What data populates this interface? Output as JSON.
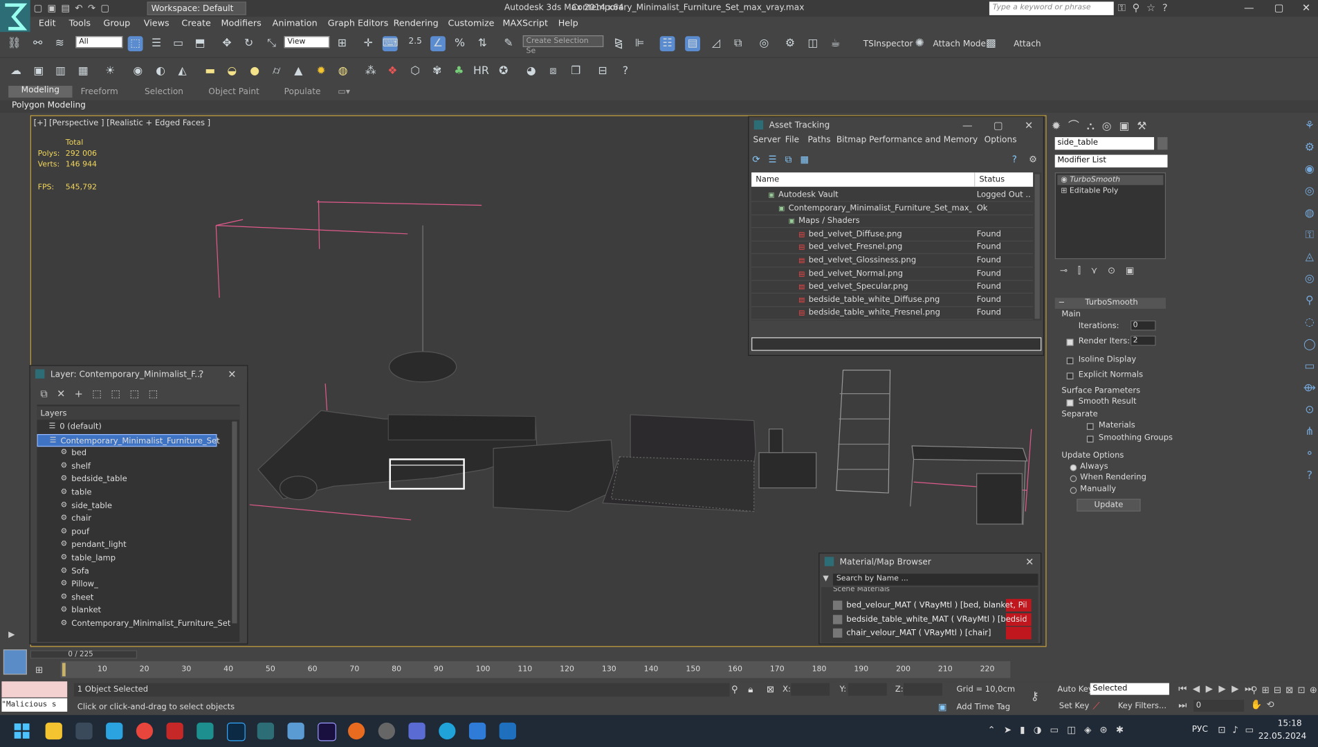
{
  "titlebar": {
    "workspace": "Workspace: Default",
    "app": "Autodesk 3ds Max  2014 x64",
    "file": "Contemporary_Minimalist_Furniture_Set_max_vray.max",
    "search_placeholder": "Type a keyword or phrase"
  },
  "menubar": [
    "Edit",
    "Tools",
    "Group",
    "Views",
    "Create",
    "Modifiers",
    "Animation",
    "Graph Editors",
    "Rendering",
    "Customize",
    "MAXScript",
    "Help"
  ],
  "toolbar": {
    "selection_filter": "All",
    "ref_coord": "View",
    "snap_value": "2.5",
    "named_selection": "Create Selection Se",
    "tsinspector": "TSInspector",
    "attach_mode": "Attach Mode",
    "attach": "Attach"
  },
  "ribbon": {
    "tabs": [
      "Modeling",
      "Freeform",
      "Selection",
      "Object Paint",
      "Populate"
    ],
    "active": "Polygon Modeling"
  },
  "viewport": {
    "label": "[+] [Perspective ] [Realistic + Edged Faces ]",
    "stats": {
      "total_label": "Total",
      "polys_label": "Polys:",
      "polys": "292 006",
      "verts_label": "Verts:",
      "verts": "146 944",
      "fps_label": "FPS:",
      "fps": "545,792"
    }
  },
  "layer_panel": {
    "title": "Layer: Contemporary_Minimalist_F...",
    "header": "Layers",
    "items": [
      {
        "label": "0 (default)",
        "indent": 0
      },
      {
        "label": "Contemporary_Minimalist_Furniture_Set",
        "indent": 0,
        "selected": true
      },
      {
        "label": "bed",
        "indent": 1
      },
      {
        "label": "shelf",
        "indent": 1
      },
      {
        "label": "bedside_table",
        "indent": 1
      },
      {
        "label": "table",
        "indent": 1
      },
      {
        "label": "side_table",
        "indent": 1
      },
      {
        "label": "chair",
        "indent": 1
      },
      {
        "label": "pouf",
        "indent": 1
      },
      {
        "label": "pendant_light",
        "indent": 1
      },
      {
        "label": "table_lamp",
        "indent": 1
      },
      {
        "label": "Sofa",
        "indent": 1
      },
      {
        "label": "Pillow_",
        "indent": 1
      },
      {
        "label": "sheet",
        "indent": 1
      },
      {
        "label": "blanket",
        "indent": 1
      },
      {
        "label": "Contemporary_Minimalist_Furniture_Set",
        "indent": 1
      }
    ]
  },
  "asset_tracking": {
    "title": "Asset Tracking",
    "menu": [
      "Server",
      "File",
      "Paths",
      "Bitmap Performance and Memory",
      "Options"
    ],
    "col_name": "Name",
    "col_status": "Status",
    "rows": [
      {
        "name": "Autodesk Vault",
        "status": "Logged Out ...",
        "indent": 1
      },
      {
        "name": "Contemporary_Minimalist_Furniture_Set_max_v...",
        "status": "Ok",
        "indent": 2
      },
      {
        "name": "Maps / Shaders",
        "status": "",
        "indent": 3
      },
      {
        "name": "bed_velvet_Diffuse.png",
        "status": "Found",
        "indent": 4
      },
      {
        "name": "bed_velvet_Fresnel.png",
        "status": "Found",
        "indent": 4
      },
      {
        "name": "bed_velvet_Glossiness.png",
        "status": "Found",
        "indent": 4
      },
      {
        "name": "bed_velvet_Normal.png",
        "status": "Found",
        "indent": 4
      },
      {
        "name": "bed_velvet_Specular.png",
        "status": "Found",
        "indent": 4
      },
      {
        "name": "bedside_table_white_Diffuse.png",
        "status": "Found",
        "indent": 4
      },
      {
        "name": "bedside_table_white_Fresnel.png",
        "status": "Found",
        "indent": 4
      }
    ]
  },
  "material_browser": {
    "title": "Material/Map Browser",
    "search_placeholder": "Search by Name ...",
    "section": "Scene Materials",
    "items": [
      "bed_velour_MAT ( VRayMtl ) [bed, blanket, Pillo...",
      "bedside_table_white_MAT ( VRayMtl ) [bedside_...",
      "chair_velour_MAT ( VRayMtl ) [chair]"
    ]
  },
  "command_panel": {
    "object_name": "side_table",
    "modifier_list": "Modifier List",
    "stack": [
      "TurboSmooth",
      "Editable Poly"
    ],
    "rollout_title": "TurboSmooth",
    "main_label": "Main",
    "iterations_label": "Iterations:",
    "iterations": "0",
    "render_iters_label": "Render Iters:",
    "render_iters": "2",
    "isoline": "Isoline Display",
    "explicit_normals": "Explicit Normals",
    "surface_params": "Surface Parameters",
    "smooth_result": "Smooth Result",
    "separate": "Separate",
    "materials": "Materials",
    "smoothing_groups": "Smoothing Groups",
    "update_options": "Update Options",
    "always": "Always",
    "when_rendering": "When Rendering",
    "manually": "Manually",
    "update_btn": "Update"
  },
  "timeline": {
    "frame": "0 / 225",
    "ticks": [
      "10",
      "20",
      "30",
      "40",
      "50",
      "60",
      "70",
      "80",
      "90",
      "100",
      "110",
      "120",
      "130",
      "140",
      "150",
      "160",
      "170",
      "180",
      "190",
      "200",
      "210",
      "220"
    ]
  },
  "status": {
    "maxscript": "\"Malicious s",
    "selected": "1 Object Selected",
    "prompt": "Click or click-and-drag to select objects",
    "x_label": "X:",
    "y_label": "Y:",
    "z_label": "Z:",
    "grid": "Grid = 10,0cm",
    "add_time_tag": "Add Time Tag",
    "auto_key": "Auto Key",
    "set_key": "Set Key",
    "selected_dd": "Selected",
    "key_filters": "Key Filters...",
    "frame_field": "0"
  },
  "taskbar": {
    "lang": "РУС",
    "time": "15:18",
    "date": "22.05.2024"
  }
}
